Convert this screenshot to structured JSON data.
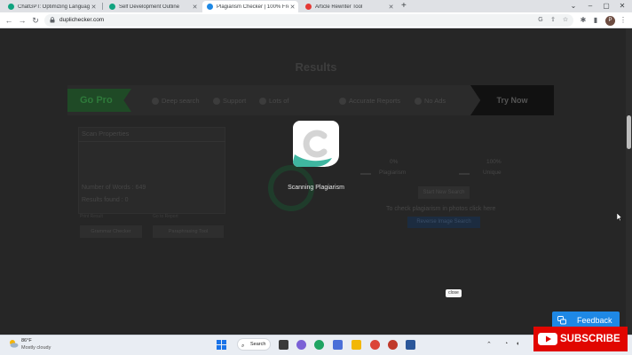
{
  "browser": {
    "tabs": [
      {
        "title": "ChatGPT: Optimizing Language M",
        "favicon_color": "#10a37f",
        "active": false
      },
      {
        "title": "Self Development Outline",
        "favicon_color": "#10a37f",
        "active": false
      },
      {
        "title": "Plagiarism Checker | 100% Free a",
        "favicon_color": "#1e88e5",
        "active": true
      },
      {
        "title": "Article Rewriter Tool",
        "favicon_color": "#e53935",
        "active": false
      }
    ],
    "url": "duplichecker.com",
    "profile_initial": "P"
  },
  "page": {
    "results_title": "Results",
    "go_pro": "Go Pro",
    "features": [
      "Deep search",
      "Support",
      "Lots of",
      "Accurate Reports",
      "No Ads"
    ],
    "try_now": "Try Now",
    "scan_properties": {
      "title": "Scan Properties",
      "words_label": "Number of Words : 649",
      "results_label": "Results found : 0",
      "print_label": "Print Result",
      "share_label": "Go to Report",
      "btn_left": "Grammar Checker",
      "btn_right": "Paraphrasing Tool"
    },
    "plagiarism_pct": "0%",
    "plagiarism_label": "Plagiarism",
    "unique_pct": "100%",
    "unique_label": "Unique",
    "start_new_search": "Start New Search",
    "photo_text": "To check plagiarism in photos click here",
    "reverse_image": "Reverse Image Search"
  },
  "overlay": {
    "status": "Scanning Plagiarism",
    "close": "close",
    "feedback": "Feedback"
  },
  "taskbar": {
    "temp": "86°F",
    "condition": "Mostly cloudy",
    "search": "Search"
  },
  "subscribe": "SUBSCRIBE",
  "colors": {
    "feedback_blue": "#1e88e5",
    "subscribe_red": "#e10600",
    "logo_green": "#3fb6a0"
  }
}
